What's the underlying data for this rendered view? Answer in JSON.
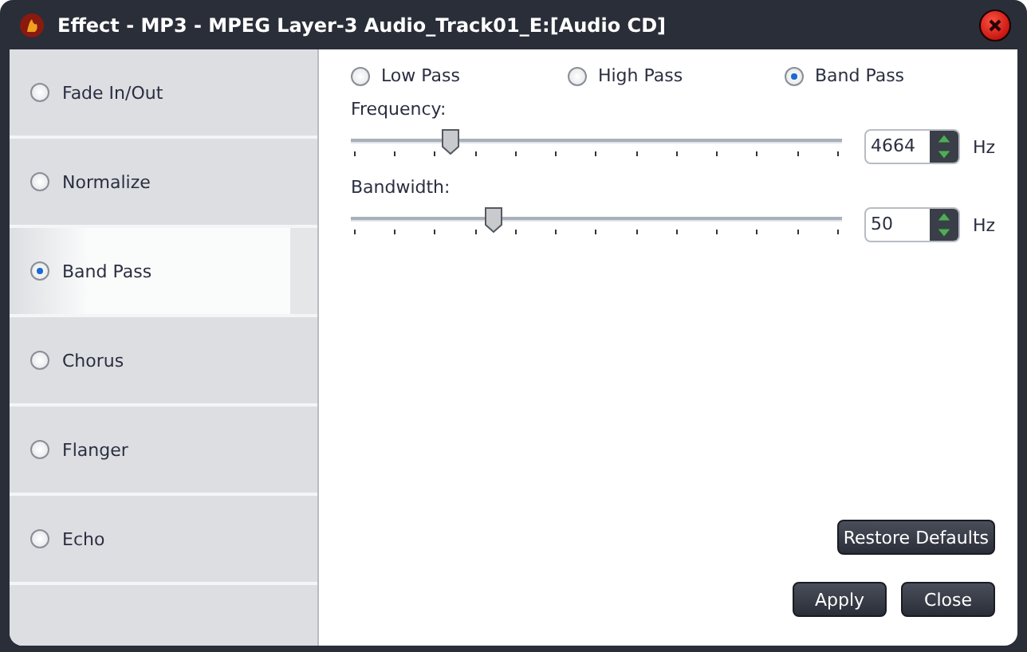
{
  "window": {
    "title": "Effect - MP3 - MPEG Layer-3 Audio_Track01_E:[Audio CD]"
  },
  "effects": [
    {
      "label": "Fade In/Out",
      "selected": false
    },
    {
      "label": "Normalize",
      "selected": false
    },
    {
      "label": "Band Pass",
      "selected": true
    },
    {
      "label": "Chorus",
      "selected": false
    },
    {
      "label": "Flanger",
      "selected": false
    },
    {
      "label": "Echo",
      "selected": false
    }
  ],
  "filter_types": [
    {
      "label": "Low Pass",
      "selected": false
    },
    {
      "label": "High Pass",
      "selected": false
    },
    {
      "label": "Band Pass",
      "selected": true
    }
  ],
  "sliders": [
    {
      "label": "Frequency:",
      "level": 0.2,
      "value": "4664",
      "unit": "Hz"
    },
    {
      "label": "Bandwidth:",
      "level": 0.29,
      "value": "50",
      "unit": "Hz"
    }
  ],
  "buttons": {
    "restore": "Restore Defaults",
    "apply": "Apply",
    "close": "Close"
  }
}
